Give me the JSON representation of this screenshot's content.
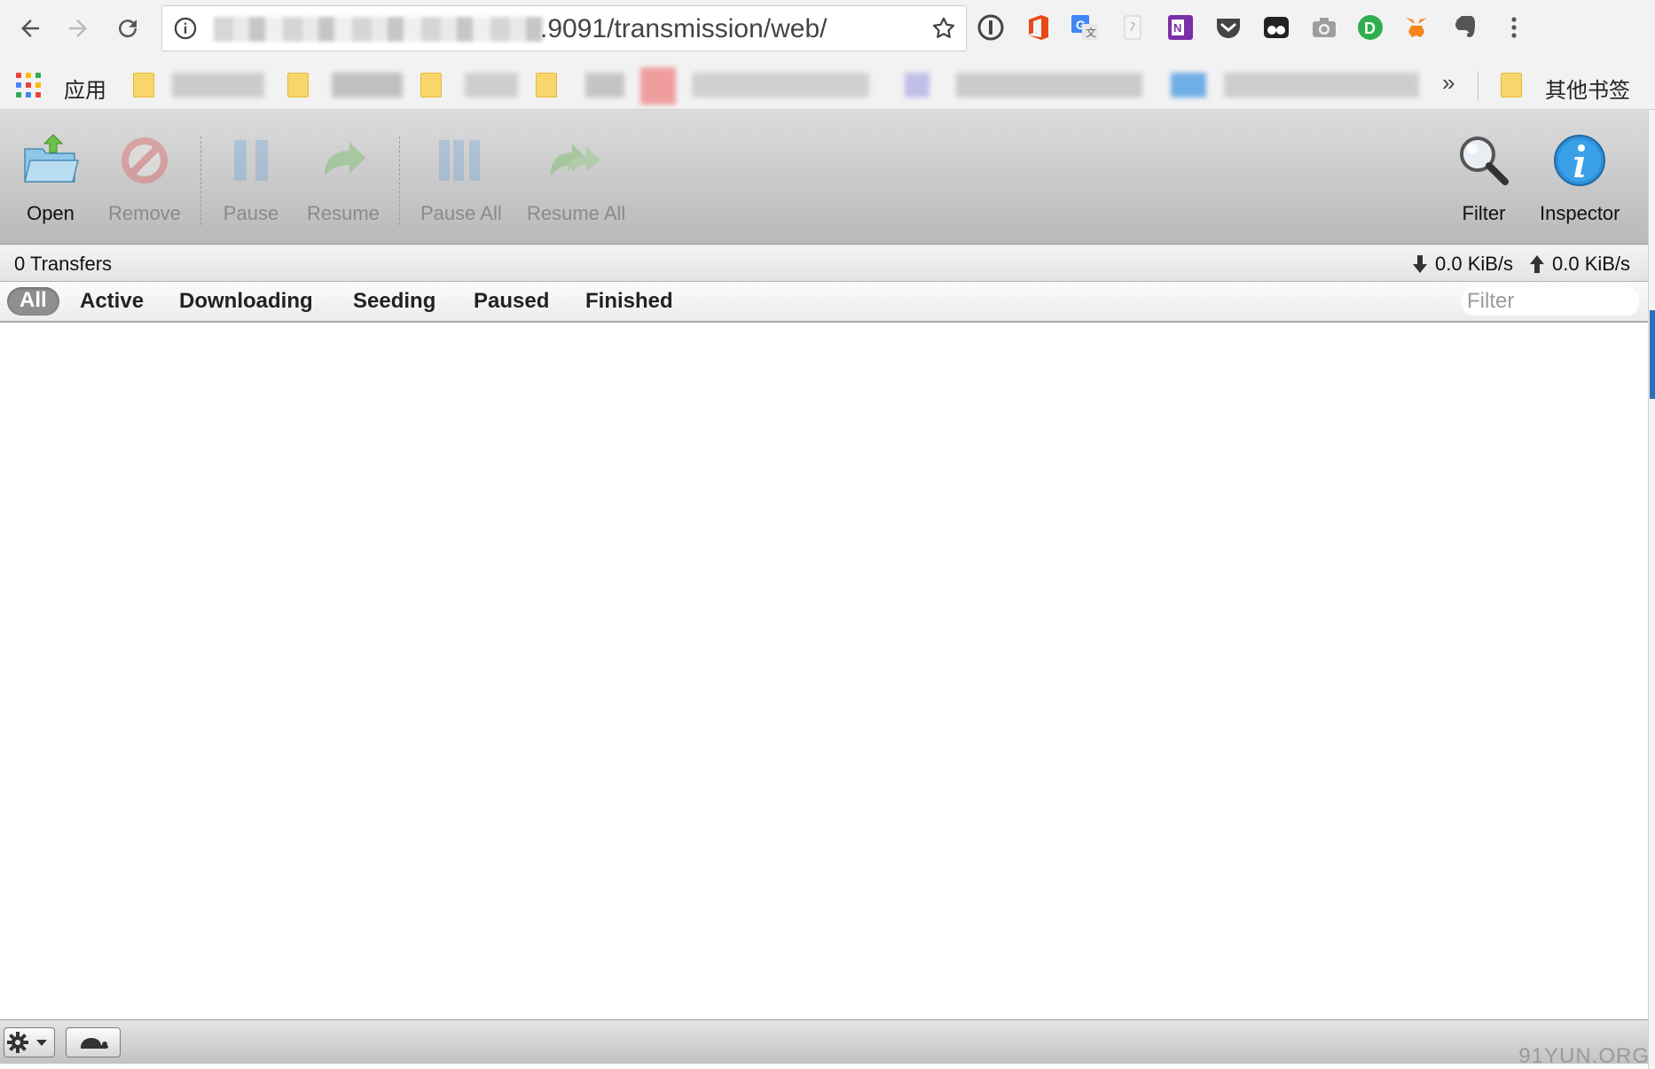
{
  "browser": {
    "url_visible": ".9091/transmission/web/",
    "bookmarks": {
      "apps_label": "应用",
      "other_label": "其他书签",
      "more_label": "»"
    },
    "extensions": [
      "1password-icon",
      "office-icon",
      "translate-icon",
      "note-icon",
      "onenote-icon",
      "pocket-icon",
      "eyes-icon",
      "camera-icon",
      "green-d-icon",
      "metamask-icon",
      "evernote-icon",
      "menu-icon"
    ]
  },
  "toolbar": {
    "open": "Open",
    "remove": "Remove",
    "pause": "Pause",
    "resume": "Resume",
    "pause_all": "Pause All",
    "resume_all": "Resume All",
    "filter": "Filter",
    "inspector": "Inspector"
  },
  "status": {
    "transfers": "0 Transfers",
    "download_speed": "0.0 KiB/s",
    "upload_speed": "0.0 KiB/s"
  },
  "filters": {
    "tabs": [
      "All",
      "Active",
      "Downloading",
      "Seeding",
      "Paused",
      "Finished"
    ],
    "selected": "All",
    "search_placeholder": "Filter"
  },
  "watermark": "91YUN.ORG"
}
